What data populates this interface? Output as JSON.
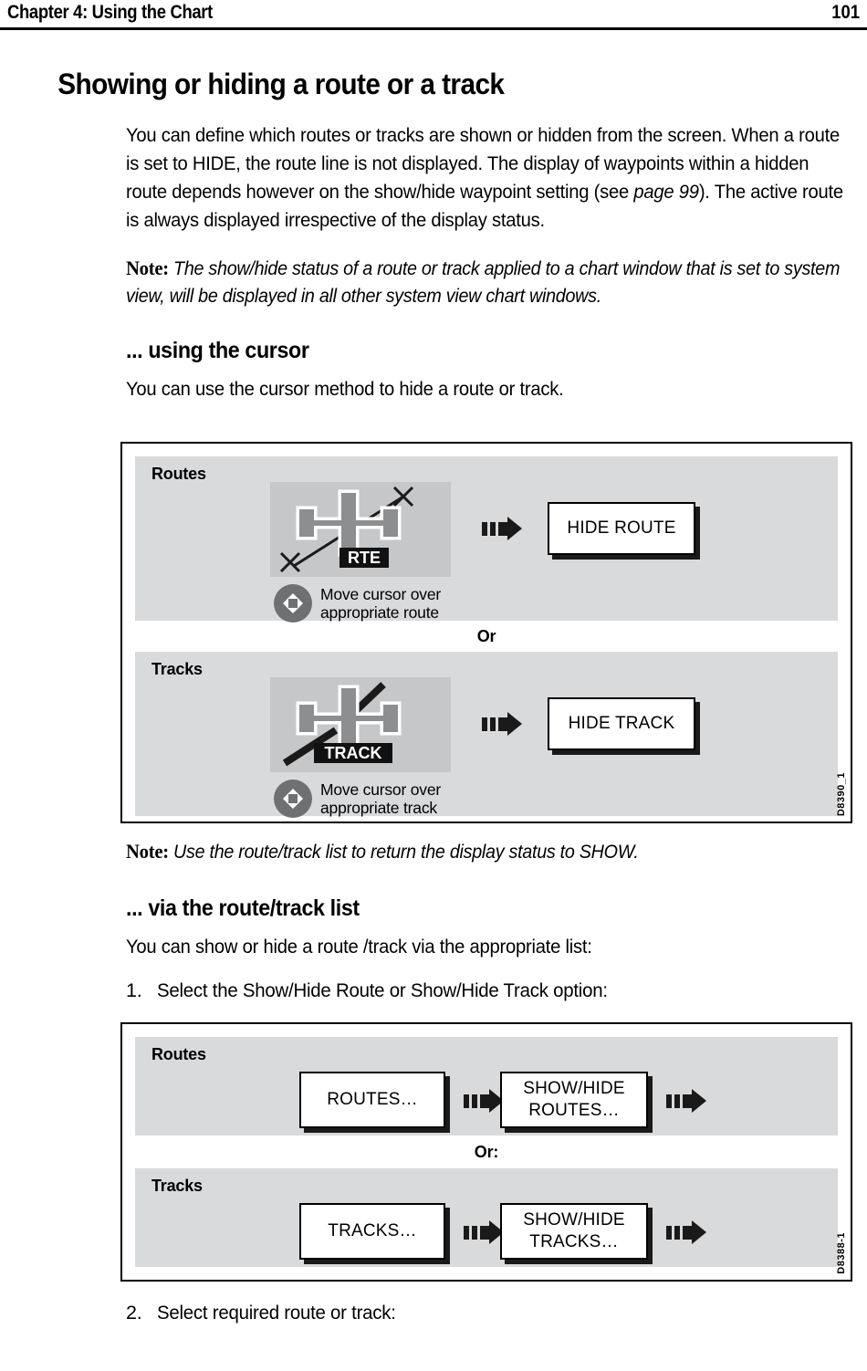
{
  "header": {
    "chapter": "Chapter 4: Using the Chart",
    "page_number": "101"
  },
  "section": {
    "title": "Showing or hiding a route or a track",
    "intro_p1": "You can define which routes or tracks are shown or hidden from the screen. When a route is set to HIDE, the route line is not displayed. The display of waypoints within a hidden route depends however on the show/hide waypoint setting (see ",
    "intro_page_ref": "page 99",
    "intro_p1_end": "). The active route is always displayed irrespective of the display status.",
    "note1_label": "Note:",
    "note1_text": "The show/hide status of a route or track applied to a chart window that is set to system view, will be displayed in all other system view chart windows."
  },
  "cursor_section": {
    "heading": "... using the cursor",
    "intro": "You can use the cursor method to hide a route or track.",
    "note_label": "Note:",
    "note_text": "Use the route/track list to return the display status to SHOW."
  },
  "figure1": {
    "id": "D8390_1",
    "or_label": "Or",
    "routes": {
      "panel_label": "Routes",
      "chart_tag": "RTE",
      "caption": "Move cursor over\nappropriate route",
      "button": "HIDE ROUTE"
    },
    "tracks": {
      "panel_label": "Tracks",
      "chart_tag": "TRACK",
      "caption": "Move cursor over\nappropriate track",
      "button": "HIDE TRACK"
    }
  },
  "list_section": {
    "heading": "... via the route/track list",
    "intro": "You can show or hide a route /track via the appropriate list:",
    "step1_num": "1.",
    "step1_text": "Select the Show/Hide Route or Show/Hide Track option:",
    "step2_num": "2.",
    "step2_text": "Select required route or track:"
  },
  "figure2": {
    "id": "D8388-1",
    "or_label": "Or:",
    "routes": {
      "panel_label": "Routes",
      "button1": "ROUTES…",
      "button2": "SHOW/HIDE\nROUTES…"
    },
    "tracks": {
      "panel_label": "Tracks",
      "button1": "TRACKS…",
      "button2": "SHOW/HIDE\nTRACKS…"
    }
  },
  "colors": {
    "panel_bg": "#d9dadc",
    "chart_bg": "#c6c7c9",
    "ink": "#000000",
    "dpad": "#6f7072"
  }
}
